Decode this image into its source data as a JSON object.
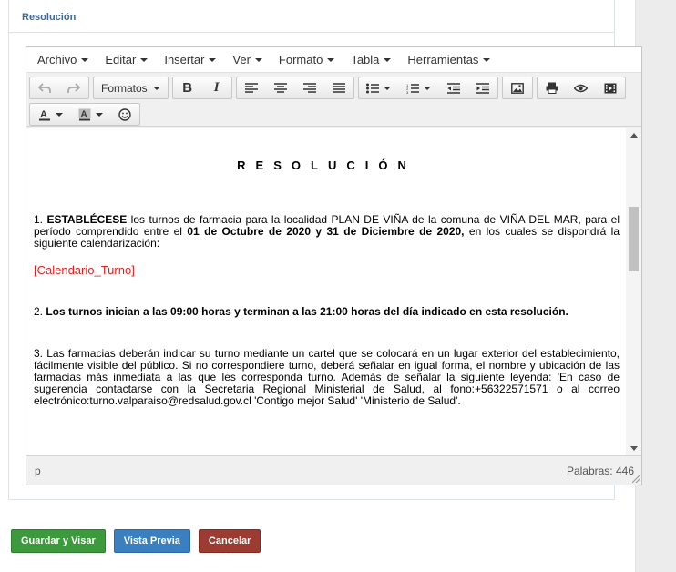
{
  "panel": {
    "title": "Resolución"
  },
  "menubar": {
    "items": [
      {
        "label": "Archivo"
      },
      {
        "label": "Editar"
      },
      {
        "label": "Insertar"
      },
      {
        "label": "Ver"
      },
      {
        "label": "Formato"
      },
      {
        "label": "Tabla"
      },
      {
        "label": "Herramientas"
      }
    ]
  },
  "toolbar": {
    "formats_label": "Formatos",
    "icons": [
      "undo-icon",
      "redo-icon",
      "bold-icon",
      "italic-icon",
      "align-left-icon",
      "align-center-icon",
      "align-right-icon",
      "align-justify-icon",
      "bullet-list-icon",
      "numbered-list-icon",
      "outdent-icon",
      "indent-icon",
      "image-icon",
      "print-icon",
      "preview-icon",
      "media-icon",
      "text-color-icon",
      "background-color-icon",
      "emoticons-icon"
    ]
  },
  "document": {
    "title": "RESOLUCIÓN",
    "p1_num": "1. ",
    "p1_bold": "ESTABLÉCESE",
    "p1_text_a": " los turnos de farmacia para la localidad PLAN DE VIÑA de la comuna de VIÑA DEL MAR, para el período comprendido entre el ",
    "p1_dates": "01 de Octubre de 2020 y 31 de Diciembre de 2020,",
    "p1_text_b": " en los cuales se dispondrá la siguiente calendarización:",
    "placeholder": "[Calendario_Turno]",
    "p2_num": "2. ",
    "p2_bold": "Los turnos inician a las 09:00 horas y terminan a las 21:00 horas del día indicado en esta resolución.",
    "p3": "3. Las farmacias deberán indicar su turno mediante un cartel que se colocará en un lugar exterior del establecimiento, fácilmente visible del público. Si no correspondiere turno, deberá señalar en igual forma, el nombre y ubicación de las farmacias más inmediata a las que les corresponda turno. Además de señalar la siguiente leyenda: 'En caso de sugerencia contactarse con la Secretaria Regional Ministerial de Salud, al fono:+56322571571 o al correo electrónico:turno.valparaiso@redsalud.gov.cl 'Contigo mejor Salud' 'Ministerio de Salud'."
  },
  "statusbar": {
    "path": "p",
    "word_count": "Palabras: 446"
  },
  "actions": {
    "save_label": "Guardar y Visar",
    "preview_label": "Vista Previa",
    "cancel_label": "Cancelar"
  },
  "colors": {
    "save": "#3c9a3c",
    "preview": "#3a7fbf",
    "cancel": "#9c3b31",
    "placeholder": "#e02020",
    "panel_title": "#3b6a9c"
  }
}
